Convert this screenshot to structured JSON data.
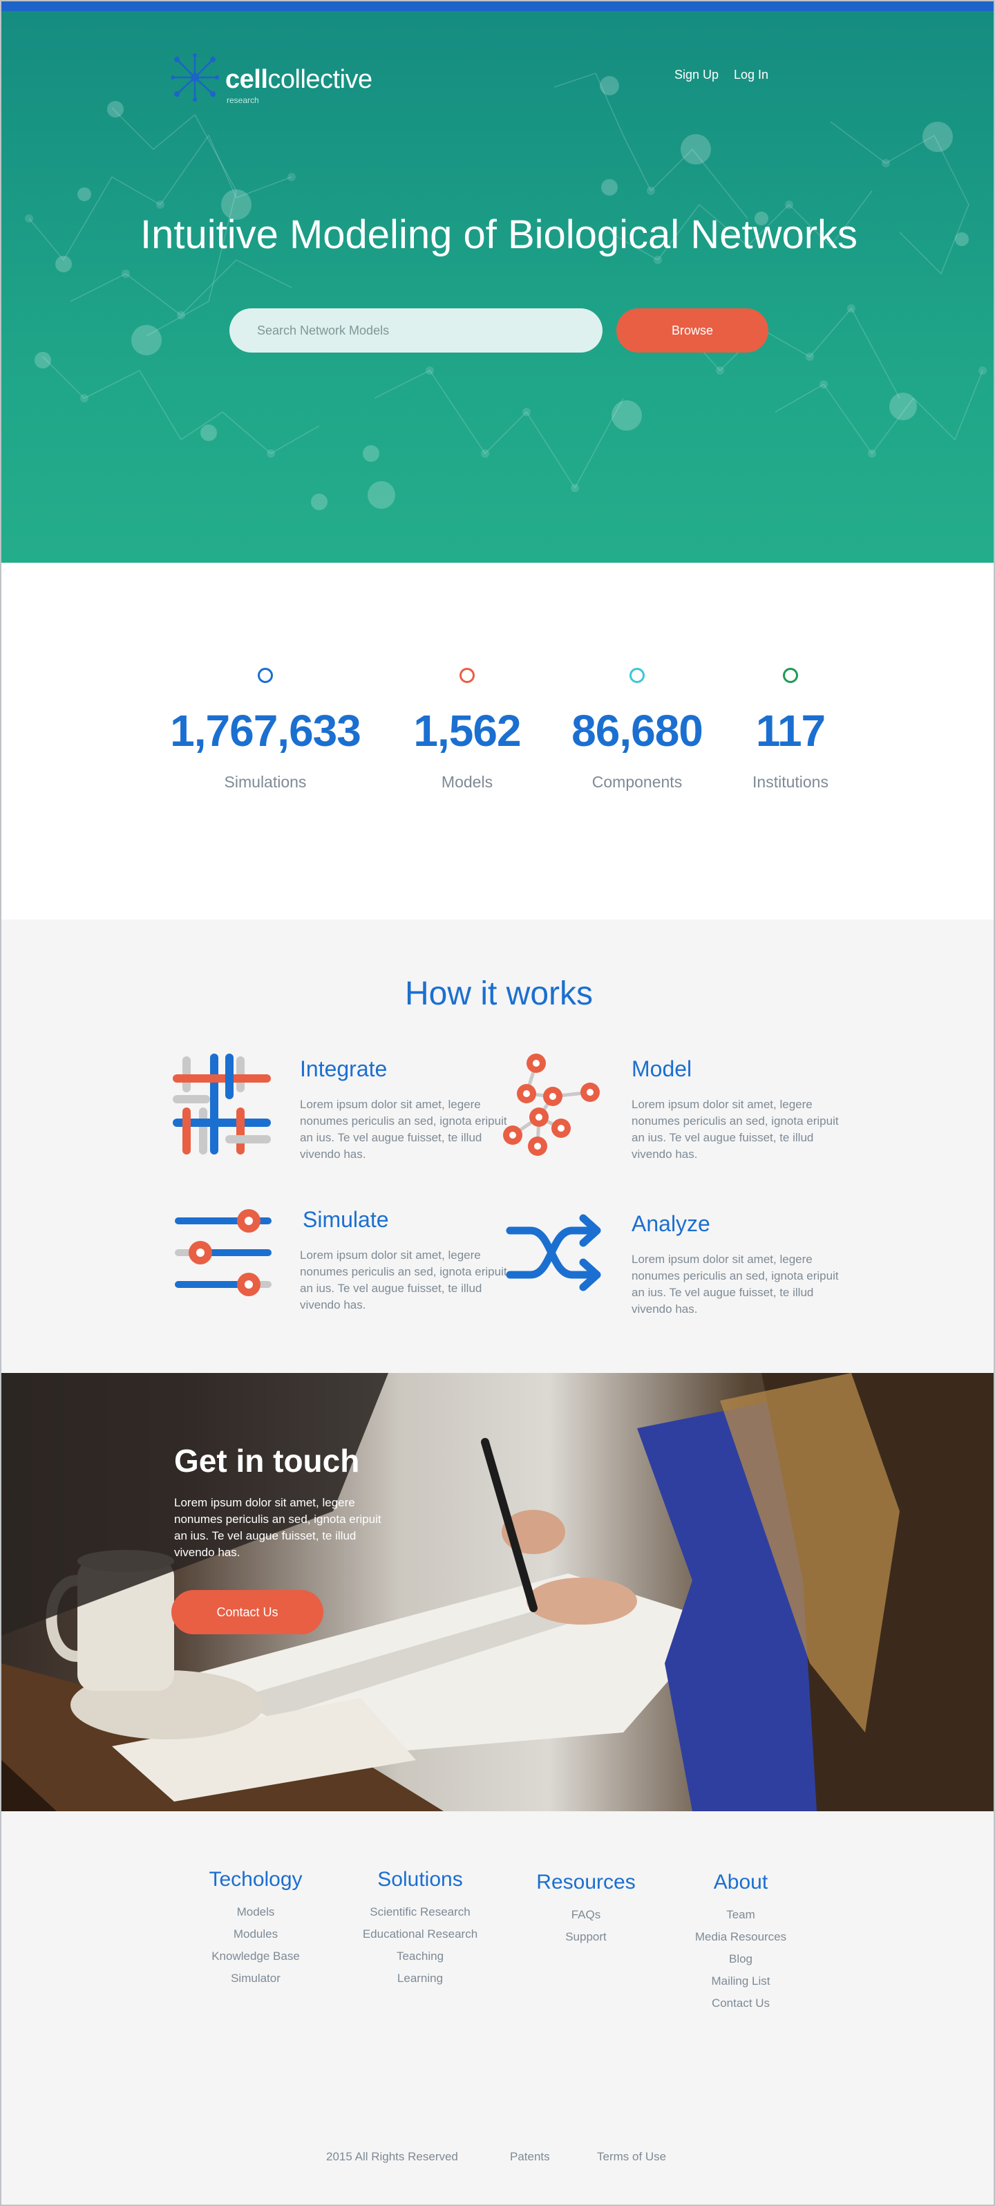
{
  "brand": {
    "name_bold": "cell",
    "name_light": "collective",
    "subline": "research"
  },
  "nav": {
    "signup": "Sign Up",
    "login": "Log In"
  },
  "hero": {
    "title": "Intuitive Modeling of Biological Networks",
    "search_placeholder": "Search Network Models",
    "browse_label": "Browse"
  },
  "stats": [
    {
      "value": "1,767,633",
      "label": "Simulations",
      "color": "#1b6fd0"
    },
    {
      "value": "1,562",
      "label": "Models",
      "color": "#e85f44"
    },
    {
      "value": "86,680",
      "label": "Components",
      "color": "#3cc6d8"
    },
    {
      "value": "117",
      "label": "Institutions",
      "color": "#1f9a55"
    }
  ],
  "how": {
    "title": "How it works",
    "features": [
      {
        "title": "Integrate",
        "icon": "integrate-icon",
        "text": "Lorem ipsum dolor sit amet, legere nonumes periculis an sed, ignota eripuit an ius. Te vel augue fuisset, te illud vivendo has."
      },
      {
        "title": "Model",
        "icon": "network-model-icon",
        "text": "Lorem ipsum dolor sit amet, legere nonumes periculis an sed, ignota eripuit an ius. Te vel augue fuisset, te illud vivendo has."
      },
      {
        "title": "Simulate",
        "icon": "sliders-icon",
        "text": "Lorem ipsum dolor sit amet, legere nonumes periculis an sed, ignota eripuit an ius. Te vel augue fuisset, te illud vivendo has."
      },
      {
        "title": "Analyze",
        "icon": "shuffle-icon",
        "text": "Lorem ipsum dolor sit amet, legere nonumes periculis an sed, ignota eripuit an ius. Te vel augue fuisset, te illud vivendo has."
      }
    ]
  },
  "contact": {
    "title": "Get in touch",
    "text": "Lorem ipsum dolor sit amet, legere nonumes periculis an sed, ignota eripuit an ius. Te vel augue fuisset, te illud vivendo has.",
    "button_label": "Contact Us"
  },
  "footer": {
    "columns": [
      {
        "title": "Techology",
        "links": [
          "Models",
          "Modules",
          "Knowledge Base",
          "Simulator"
        ]
      },
      {
        "title": "Solutions",
        "links": [
          "Scientific Research",
          "Educational Research",
          "Teaching",
          "Learning"
        ]
      },
      {
        "title": "Resources",
        "links": [
          "FAQs",
          "Support"
        ]
      },
      {
        "title": "About",
        "links": [
          "Team",
          "Media Resources",
          "Blog",
          "Mailing List",
          "Contact Us"
        ]
      }
    ],
    "copyright": "2015 All Rights Reserved",
    "patents": "Patents",
    "terms": "Terms of Use"
  },
  "colors": {
    "accent_blue": "#1b6fd0",
    "accent_orange": "#e85f44",
    "hero_teal": "#1a9a86",
    "top_bar": "#1e63c9"
  }
}
